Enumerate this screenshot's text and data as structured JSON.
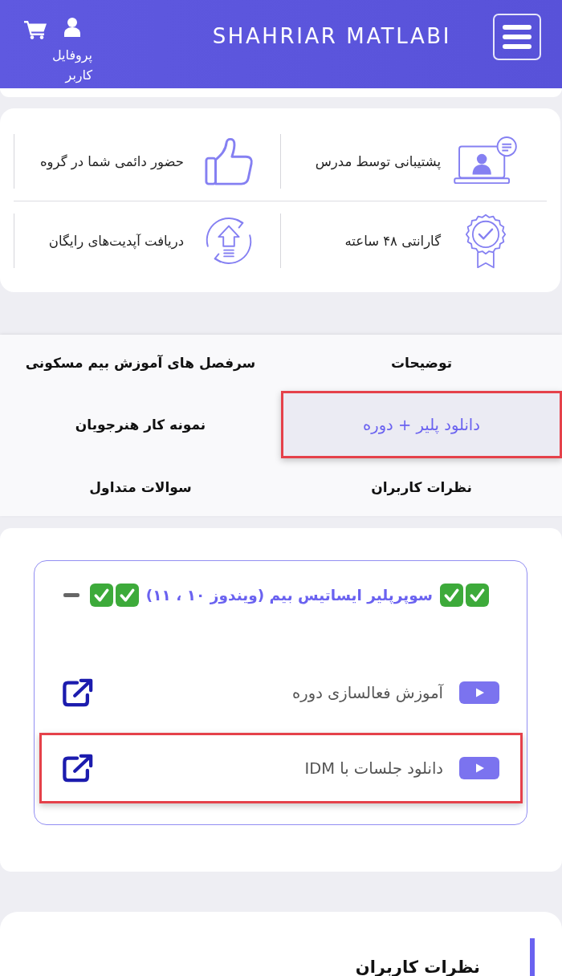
{
  "header": {
    "title": "SHAHRIAR MATLABI",
    "profile_label": "پروفایل کاربر"
  },
  "features": [
    {
      "kind": "teacher",
      "text": "پشتیبانی توسط مدرس"
    },
    {
      "kind": "thumbs_up",
      "text": "حضور دائمی شما در گروه"
    },
    {
      "kind": "badge",
      "text": "گارانتی ۴۸ ساعته"
    },
    {
      "kind": "update",
      "text": "دریافت آپدیت‌های رایگان"
    }
  ],
  "tabs": [
    {
      "label": "توضیحات",
      "selected": false,
      "highlighted": false
    },
    {
      "label": "سرفصل های آموزش بیم مسکونی",
      "selected": false,
      "highlighted": false
    },
    {
      "label": "دانلود پلیر + دوره",
      "selected": true,
      "highlighted": true
    },
    {
      "label": "نمونه کار هنرجویان",
      "selected": false,
      "highlighted": false
    },
    {
      "label": "نظرات کاربران",
      "selected": false,
      "highlighted": false
    },
    {
      "label": "سوالات متداول",
      "selected": false,
      "highlighted": false
    }
  ],
  "accordion": {
    "title": "سوپرپلیر ایساتیس بیم (ویندوز ۱۰ ، ۱۱)",
    "expanded": true,
    "links": [
      {
        "label": "آموزش فعالسازی دوره",
        "highlighted": false
      },
      {
        "label": "دانلود جلسات با IDM",
        "highlighted": true
      }
    ]
  },
  "reviews": {
    "heading": "نظرات کاربران"
  }
}
